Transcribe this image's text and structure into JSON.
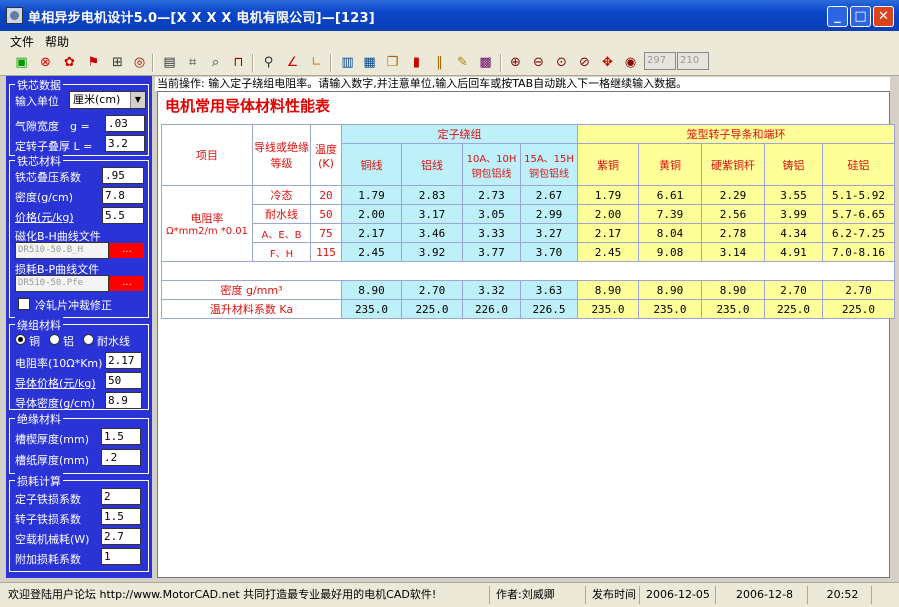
{
  "window": {
    "title": "单相异步电机设计5.0—[X X X X 电机有限公司]—[123]",
    "minimize": "_",
    "maximize": "□",
    "close": "✕"
  },
  "menu": {
    "file": "文件",
    "help": "帮助"
  },
  "toolbar": {
    "page_from": "297",
    "page_to": "210",
    "icons": [
      "recalc-icon",
      "stop-icon",
      "gear-icon",
      "flag-icon",
      "grid-icon",
      "target-icon",
      "document-icon",
      "schematic-icon",
      "winding-icon",
      "slot-icon",
      "probe-icon",
      "curve-icon",
      "chart-icon",
      "calculator-icon",
      "report-icon",
      "copy-icon",
      "bars-icon",
      "compare-icon",
      "pencil-icon",
      "graph-icon",
      "zoom-in-icon",
      "zoom-out-icon",
      "zoom-fit-icon",
      "zoom-window-icon",
      "pan-icon",
      "zoom-page-icon"
    ]
  },
  "left": {
    "core": {
      "title": "铁芯数据",
      "unit_label": "输入单位",
      "unit_value": "厘米(cm)",
      "airgap_label": "气隙宽度　g =",
      "airgap_value": ".03",
      "stack_label": "定转子叠厚 L =",
      "stack_value": "3.2"
    },
    "core_material": {
      "title": "铁芯材料",
      "fill_label": "铁芯叠压系数",
      "fill_value": ".95",
      "density_label": "密度(g/cm)",
      "density_value": "7.8",
      "price_label": "价格(元/kg)",
      "price_value": "5.5",
      "bh_label": "磁化B-H曲线文件",
      "bh_file": "DR510-50.B_H",
      "bp_label": "损耗B-P曲线文件",
      "bp_file": "DR510-50.Pfe",
      "browse": "...",
      "coldrolled_label": "冷轧片冲裁修正"
    },
    "winding_material": {
      "title": "绕组材料",
      "opt_cu": "铜",
      "opt_al": "铝",
      "opt_water": "耐水线",
      "resistivity_label": "电阻率(10Ω*Km)",
      "resistivity_value": "2.17",
      "price_label": "导体价格(元/kg)",
      "price_value": "50",
      "density_label": "导体密度(g/cm)",
      "density_value": "8.9"
    },
    "insulation": {
      "title": "绝缘材料",
      "slot_label": "槽楔厚度(mm)",
      "slot_value": "1.5",
      "paper_label": "槽纸厚度(mm)",
      "paper_value": ".2"
    },
    "loss": {
      "title": "损耗计算",
      "stator_label": "定子铁损系数",
      "stator_value": "2",
      "rotor_label": "转子铁损系数",
      "rotor_value": "1.5",
      "mech_label": "空载机械耗(W)",
      "mech_value": "2.7",
      "add_label": "附加损耗系数",
      "add_value": "1"
    }
  },
  "main": {
    "operation": "当前操作: 输入定子绕组电阻率。请输入数字,并注意单位,输入后回车或按TAB自动跳入下一格继续输入数据。",
    "sheet_title": "电机常用导体材料性能表",
    "table": {
      "h_item": "项目",
      "h_grade": "导线或绝缘等级",
      "h_temp": "温度(K)",
      "h_stator": "定子绕组",
      "h_rotor": "笼型转子导条和端环",
      "stator_cols": [
        "铜线",
        "铝线",
        "10A、10H铜包铝线",
        "15A、15H铜包铝线"
      ],
      "rotor_cols": [
        "紫铜",
        "黄铜",
        "硬紫铜杆",
        "铸铝",
        "硅铝"
      ],
      "res_label": "电阻率",
      "res_unit": "Ω*mm2/m *0.01",
      "rows": [
        {
          "grade": "冷态",
          "temp": "20",
          "stator": [
            "1.79",
            "2.83",
            "2.73",
            "2.67"
          ],
          "rotor": [
            "1.79",
            "6.61",
            "2.29",
            "3.55",
            "5.1-5.92"
          ]
        },
        {
          "grade": "耐水线",
          "temp": "50",
          "stator": [
            "2.00",
            "3.17",
            "3.05",
            "2.99"
          ],
          "rotor": [
            "2.00",
            "7.39",
            "2.56",
            "3.99",
            "5.7-6.65"
          ]
        },
        {
          "grade": "A、E、B",
          "temp": "75",
          "stator": [
            "2.17",
            "3.46",
            "3.33",
            "3.27"
          ],
          "rotor": [
            "2.17",
            "8.04",
            "2.78",
            "4.34",
            "6.2-7.25"
          ]
        },
        {
          "grade": "F、H",
          "temp": "115",
          "stator": [
            "2.45",
            "3.92",
            "3.77",
            "3.70"
          ],
          "rotor": [
            "2.45",
            "9.08",
            "3.14",
            "4.91",
            "7.0-8.16"
          ]
        }
      ],
      "density_label": "密度 g/mm³",
      "density_stator": [
        "8.90",
        "2.70",
        "3.32",
        "3.63"
      ],
      "density_rotor": [
        "8.90",
        "8.90",
        "8.90",
        "2.70",
        "2.70"
      ],
      "temp_label": "温升材料系数 Ka",
      "temp_stator": [
        "235.0",
        "225.0",
        "226.0",
        "226.5"
      ],
      "temp_rotor": [
        "235.0",
        "235.0",
        "235.0",
        "225.0",
        "225.0"
      ]
    }
  },
  "status": {
    "forum": "欢迎登陆用户论坛 http://www.MotorCAD.net 共同打造最专业最好用的电机CAD软件!",
    "author": "作者:刘威卿",
    "released_label": "发布时间",
    "released_date": "2006-12-05",
    "today": "2006-12-8",
    "time": "20:52"
  }
}
